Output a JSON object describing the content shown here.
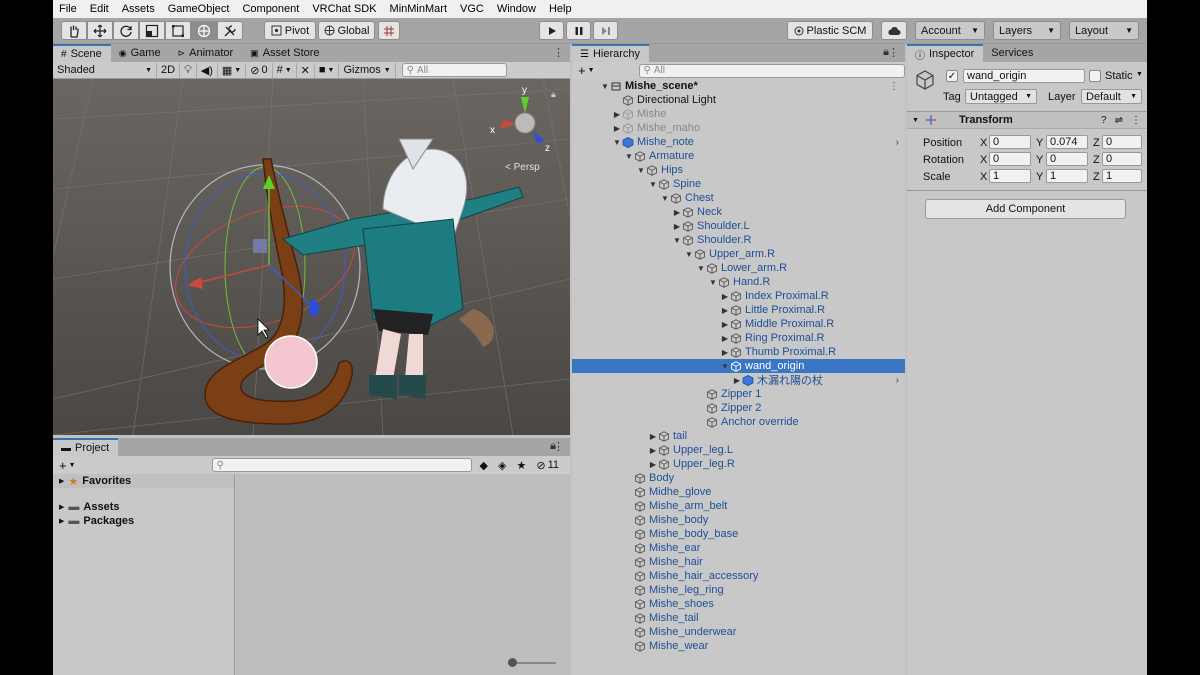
{
  "menubar": [
    "File",
    "Edit",
    "Assets",
    "GameObject",
    "Component",
    "VRChat SDK",
    "MinMinMart",
    "VGC",
    "Window",
    "Help"
  ],
  "toolbar": {
    "pivot_label": "Pivot",
    "global_label": "Global",
    "plastic_label": "Plastic SCM",
    "account_label": "Account",
    "layers_label": "Layers",
    "layout_label": "Layout"
  },
  "scene": {
    "tabs": [
      "Scene",
      "Game",
      "Animator",
      "Asset Store"
    ],
    "shading": "Shaded",
    "mode_2d": "2D",
    "hidden_count": "0",
    "gizmos_label": "Gizmos",
    "search_placeholder": "All",
    "persp_label": "< Persp",
    "axes": {
      "y": "y",
      "x": "x",
      "z": "z"
    }
  },
  "project": {
    "tab": "Project",
    "hidden_count": "11",
    "favorites_label": "Favorites",
    "folders": [
      "Assets",
      "Packages"
    ]
  },
  "hierarchy": {
    "tab": "Hierarchy",
    "search_placeholder": "All",
    "rows": [
      {
        "label": "Mishe_scene*",
        "depth": 0,
        "arrow": "down",
        "icon": "scene",
        "style": "bold"
      },
      {
        "label": "Directional Light",
        "depth": 1,
        "arrow": "",
        "icon": "cube",
        "style": ""
      },
      {
        "label": "Mishe",
        "depth": 1,
        "arrow": "right",
        "icon": "cube",
        "style": "grey"
      },
      {
        "label": "Mishe_maho",
        "depth": 1,
        "arrow": "right",
        "icon": "cube",
        "style": "grey"
      },
      {
        "label": "Mishe_note",
        "depth": 1,
        "arrow": "down",
        "icon": "prefab",
        "style": "blue",
        "more": true
      },
      {
        "label": "Armature",
        "depth": 2,
        "arrow": "down",
        "icon": "cube",
        "style": "blue"
      },
      {
        "label": "Hips",
        "depth": 3,
        "arrow": "down",
        "icon": "cube",
        "style": "blue"
      },
      {
        "label": "Spine",
        "depth": 4,
        "arrow": "down",
        "icon": "cube",
        "style": "blue"
      },
      {
        "label": "Chest",
        "depth": 5,
        "arrow": "down",
        "icon": "cube",
        "style": "blue"
      },
      {
        "label": "Neck",
        "depth": 6,
        "arrow": "right",
        "icon": "cube",
        "style": "blue"
      },
      {
        "label": "Shoulder.L",
        "depth": 6,
        "arrow": "right",
        "icon": "cube",
        "style": "blue"
      },
      {
        "label": "Shoulder.R",
        "depth": 6,
        "arrow": "down",
        "icon": "cube",
        "style": "blue"
      },
      {
        "label": "Upper_arm.R",
        "depth": 7,
        "arrow": "down",
        "icon": "cube",
        "style": "blue"
      },
      {
        "label": "Lower_arm.R",
        "depth": 8,
        "arrow": "down",
        "icon": "cube",
        "style": "blue"
      },
      {
        "label": "Hand.R",
        "depth": 9,
        "arrow": "down",
        "icon": "cube",
        "style": "blue"
      },
      {
        "label": "Index Proximal.R",
        "depth": 10,
        "arrow": "right",
        "icon": "cube",
        "style": "blue"
      },
      {
        "label": "Little Proximal.R",
        "depth": 10,
        "arrow": "right",
        "icon": "cube",
        "style": "blue"
      },
      {
        "label": "Middle Proximal.R",
        "depth": 10,
        "arrow": "right",
        "icon": "cube",
        "style": "blue"
      },
      {
        "label": "Ring Proximal.R",
        "depth": 10,
        "arrow": "right",
        "icon": "cube",
        "style": "blue"
      },
      {
        "label": "Thumb Proximal.R",
        "depth": 10,
        "arrow": "right",
        "icon": "cube",
        "style": "blue"
      },
      {
        "label": "wand_origin",
        "depth": 10,
        "arrow": "down",
        "icon": "cube-plus",
        "style": "sel"
      },
      {
        "label": "木漏れ陽の杖",
        "depth": 11,
        "arrow": "right",
        "icon": "prefab",
        "style": "blue",
        "more": true
      },
      {
        "label": "Zipper 1",
        "depth": 8,
        "arrow": "",
        "icon": "cube",
        "style": "blue"
      },
      {
        "label": "Zipper 2",
        "depth": 8,
        "arrow": "",
        "icon": "cube",
        "style": "blue"
      },
      {
        "label": "Anchor override",
        "depth": 8,
        "arrow": "",
        "icon": "cube",
        "style": "blue"
      },
      {
        "label": "tail",
        "depth": 4,
        "arrow": "right",
        "icon": "cube",
        "style": "blue"
      },
      {
        "label": "Upper_leg.L",
        "depth": 4,
        "arrow": "right",
        "icon": "cube",
        "style": "blue"
      },
      {
        "label": "Upper_leg.R",
        "depth": 4,
        "arrow": "right",
        "icon": "cube",
        "style": "blue"
      },
      {
        "label": "Body",
        "depth": 2,
        "arrow": "",
        "icon": "cube",
        "style": "blue"
      },
      {
        "label": "Midhe_glove",
        "depth": 2,
        "arrow": "",
        "icon": "cube",
        "style": "blue"
      },
      {
        "label": "Mishe_arm_belt",
        "depth": 2,
        "arrow": "",
        "icon": "cube",
        "style": "blue"
      },
      {
        "label": "Mishe_body",
        "depth": 2,
        "arrow": "",
        "icon": "cube",
        "style": "blue"
      },
      {
        "label": "Mishe_body_base",
        "depth": 2,
        "arrow": "",
        "icon": "cube",
        "style": "blue"
      },
      {
        "label": "Mishe_ear",
        "depth": 2,
        "arrow": "",
        "icon": "cube",
        "style": "blue"
      },
      {
        "label": "Mishe_hair",
        "depth": 2,
        "arrow": "",
        "icon": "cube",
        "style": "blue"
      },
      {
        "label": "Mishe_hair_accessory",
        "depth": 2,
        "arrow": "",
        "icon": "cube",
        "style": "blue"
      },
      {
        "label": "Mishe_leg_ring",
        "depth": 2,
        "arrow": "",
        "icon": "cube",
        "style": "blue"
      },
      {
        "label": "Mishe_shoes",
        "depth": 2,
        "arrow": "",
        "icon": "cube",
        "style": "blue"
      },
      {
        "label": "Mishe_tail",
        "depth": 2,
        "arrow": "",
        "icon": "cube",
        "style": "blue"
      },
      {
        "label": "Mishe_underwear",
        "depth": 2,
        "arrow": "",
        "icon": "cube",
        "style": "blue"
      },
      {
        "label": "Mishe_wear",
        "depth": 2,
        "arrow": "",
        "icon": "cube",
        "style": "blue"
      }
    ]
  },
  "inspector": {
    "tabs": [
      "Inspector",
      "Services"
    ],
    "object_name": "wand_origin",
    "static_label": "Static",
    "tag_label": "Tag",
    "tag_value": "Untagged",
    "layer_label": "Layer",
    "layer_value": "Default",
    "transform_label": "Transform",
    "position_label": "Position",
    "rotation_label": "Rotation",
    "scale_label": "Scale",
    "position": {
      "x": "0",
      "y": "0.074",
      "z": "0"
    },
    "rotation": {
      "x": "0",
      "y": "0",
      "z": "0"
    },
    "scale": {
      "x": "1",
      "y": "1",
      "z": "1"
    },
    "axis_x": "X",
    "axis_y": "Y",
    "axis_z": "Z",
    "add_component_label": "Add Component"
  }
}
